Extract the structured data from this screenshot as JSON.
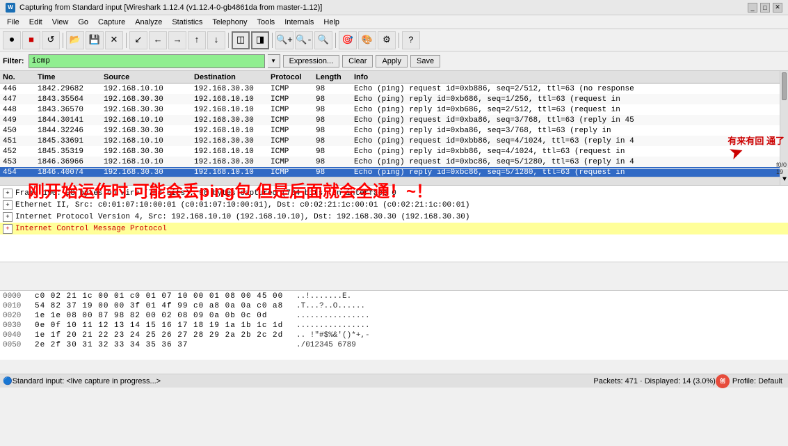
{
  "titlebar": {
    "icon": "W",
    "title": "Capturing from Standard input   [Wireshark 1.12.4  (v1.12.4-0-gb4861da from master-1.12)]",
    "minimize": "_",
    "maximize": "□",
    "close": "✕"
  },
  "menu": {
    "items": [
      "File",
      "Edit",
      "View",
      "Go",
      "Capture",
      "Analyze",
      "Statistics",
      "Telephony",
      "Tools",
      "Internals",
      "Help"
    ]
  },
  "toolbar": {
    "icons": [
      "⏺",
      "⏹",
      "📋",
      "🔄",
      "📂",
      "💾",
      "✕",
      "🔍",
      "←",
      "→",
      "📊",
      "▲",
      "⬇",
      "🔲",
      "◀",
      "▶",
      "⊕",
      "⊖",
      "🔍",
      "📸",
      "📋",
      "📤",
      "📋",
      "🔢"
    ]
  },
  "filter": {
    "label": "Filter:",
    "value": "icmp",
    "placeholder": "icmp",
    "btn_expression": "Expression...",
    "btn_clear": "Clear",
    "btn_apply": "Apply",
    "btn_save": "Save"
  },
  "packet_list": {
    "headers": [
      "No.",
      "Time",
      "Source",
      "Destination",
      "Protocol",
      "Length",
      "Info"
    ],
    "rows": [
      {
        "no": "446",
        "time": "1842.29682",
        "src": "192.168.10.10",
        "dst": "192.168.30.30",
        "proto": "ICMP",
        "len": "98",
        "info": "Echo (ping) request   id=0xb886, seq=2/512, ttl=63 (no response",
        "bg": "white"
      },
      {
        "no": "447",
        "time": "1843.35564",
        "src": "192.168.30.30",
        "dst": "192.168.10.10",
        "proto": "ICMP",
        "len": "98",
        "info": "Echo (ping) reply     id=0xb686, seq=1/256, ttl=63 (request in",
        "bg": "white"
      },
      {
        "no": "448",
        "time": "1843.36570",
        "src": "192.168.30.30",
        "dst": "192.168.10.10",
        "proto": "ICMP",
        "len": "98",
        "info": "Echo (ping) reply     id=0xb686, seq=2/512, ttl=63 (request in",
        "bg": "white"
      },
      {
        "no": "449",
        "time": "1844.30141",
        "src": "192.168.10.10",
        "dst": "192.168.30.30",
        "proto": "ICMP",
        "len": "98",
        "info": "Echo (ping) request   id=0xba86, seq=3/768, ttl=63 (reply in 45",
        "bg": "white"
      },
      {
        "no": "450",
        "time": "1844.32246",
        "src": "192.168.30.30",
        "dst": "192.168.10.10",
        "proto": "ICMP",
        "len": "98",
        "info": "Echo (ping) reply     id=0xba86, seq=3/768, ttl=63 (reply in",
        "bg": "white"
      },
      {
        "no": "451",
        "time": "1845.33691",
        "src": "192.168.10.10",
        "dst": "192.168.30.30",
        "proto": "ICMP",
        "len": "98",
        "info": "Echo (ping) request   id=0xbb86, seq=4/1024, ttl=63 (reply in 4",
        "bg": "white"
      },
      {
        "no": "452",
        "time": "1845.35319",
        "src": "192.168.30.30",
        "dst": "192.168.10.10",
        "proto": "ICMP",
        "len": "98",
        "info": "Echo (ping) reply     id=0xbb86, seq=4/1024, ttl=63 (request in",
        "bg": "white"
      },
      {
        "no": "453",
        "time": "1846.36966",
        "src": "192.168.10.10",
        "dst": "192.168.30.30",
        "proto": "ICMP",
        "len": "98",
        "info": "Echo (ping) request   id=0xbc86, seq=5/1280, ttl=63 (reply in 4",
        "bg": "white"
      },
      {
        "no": "454",
        "time": "1846.40074",
        "src": "192.168.30.30",
        "dst": "192.168.10.10",
        "proto": "ICMP",
        "len": "98",
        "info": "Echo (ping) reply     id=0xbc86, seq=5/1280, ttl=63 (request in",
        "bg": "selected"
      }
    ]
  },
  "packet_detail": {
    "rows": [
      {
        "expand": "+",
        "text": "Frame 190: 98 bytes on wire (784 bits), 98 bytes captured (784 bits) on interface 0",
        "highlighted": false
      },
      {
        "expand": "+",
        "text": "Ethernet II, Src: c0:01:07:10:00:01 (c0:01:07:10:00:01), Dst: c0:02:21:1c:00:01 (c0:02:21:1c:00:01)",
        "highlighted": false
      },
      {
        "expand": "+",
        "text": "Internet Protocol Version 4, Src: 192.168.10.10 (192.168.10.10), Dst: 192.168.30.30 (192.168.30.30)",
        "highlighted": false
      },
      {
        "expand": "+",
        "text": "Internet Control Message Protocol",
        "highlighted": true
      }
    ]
  },
  "annotation": {
    "arrow_text": "有来有回 通了",
    "large_text": "刚开始运作时  可能会丢ping包 但是后面就会全通！~！"
  },
  "hex_rows": [
    {
      "offset": "0000",
      "hex": "c0 02 21 1c 00 01  c0 01  07 10 00 01 08 00 45 00",
      "ascii": "..!.......E."
    },
    {
      "offset": "0010",
      "hex": "54 82 37 19 00 00  3f 01  4f 99 c0 a8 0a 0a c0 a8",
      "ascii": ".T...?..O......"
    },
    {
      "offset": "0020",
      "hex": "1e 1e 08 00 87 98  82 00  02 08 09 0a 0b 0c 0d",
      "ascii": "................"
    },
    {
      "offset": "0030",
      "hex": "0e 0f 10 11 12 13  14 15  16 17 18 19 1a 1b 1c 1d",
      "ascii": "................"
    },
    {
      "offset": "0040",
      "hex": "1e 1f 20 21 22 23  24 25  26 27 28 29 2a 2b 2c 2d",
      "ascii": ".. !\"#$%&'()*+,-"
    },
    {
      "offset": "0050",
      "hex": "2e 2f 30 31 32 33  34 35  36 37",
      "ascii": "./012345 6789"
    }
  ],
  "status": {
    "left": "Standard input: <live capture in progress...>",
    "packets": "Packets: 471 · Displayed: 14 (3.0%)",
    "profile": "Profile: Default"
  },
  "scrollbar": {
    "position_label": "f0/0  19"
  }
}
